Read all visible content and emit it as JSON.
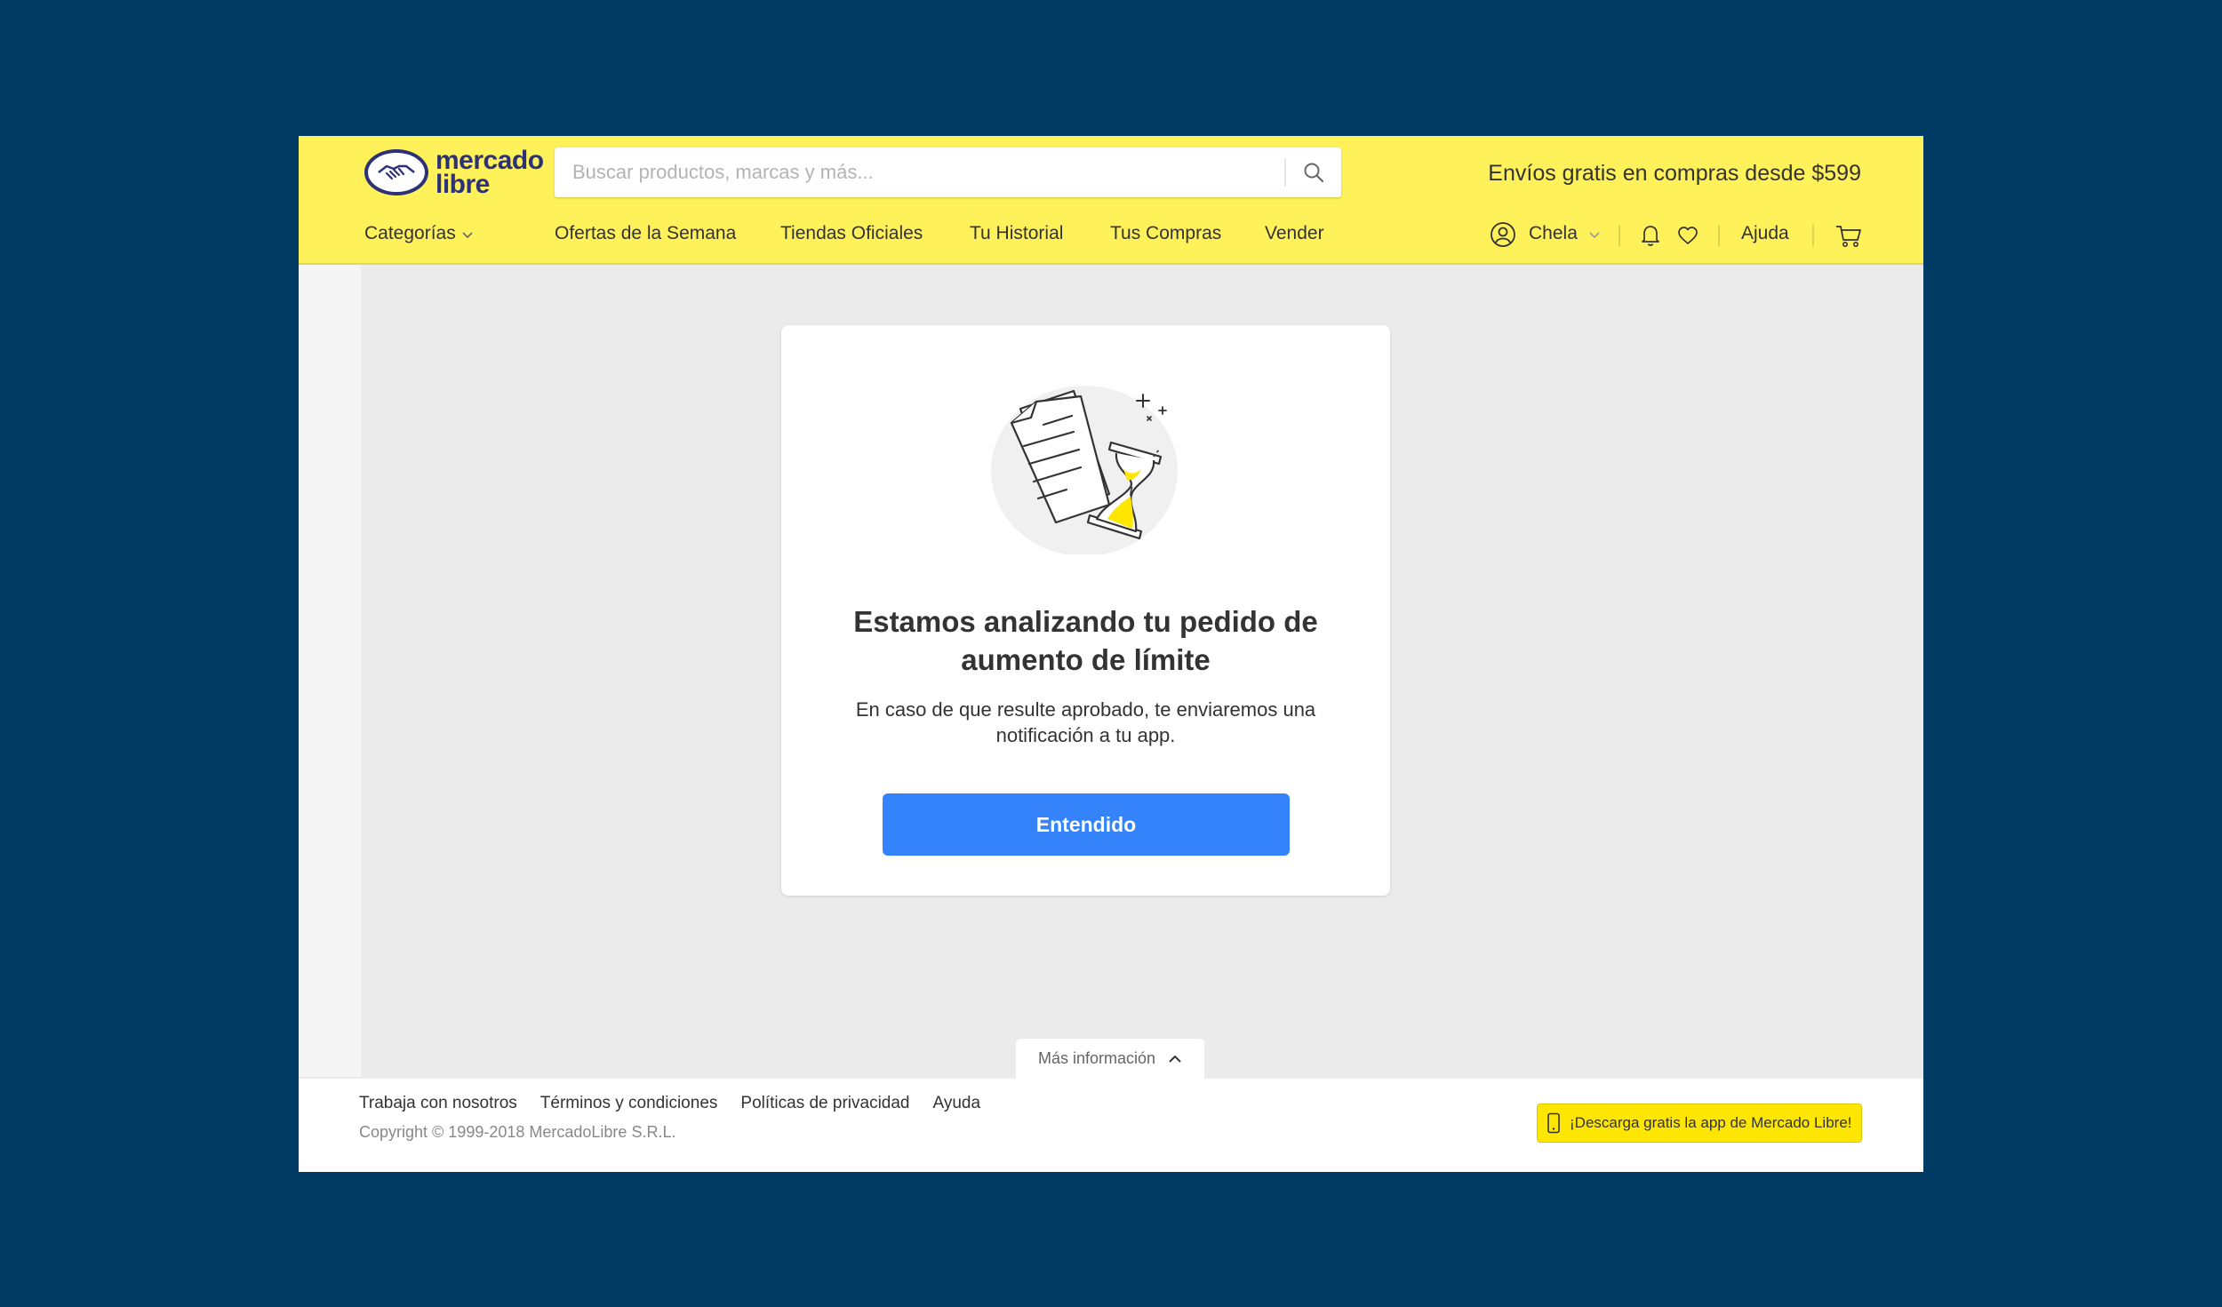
{
  "header": {
    "logo_text_line1": "mercado",
    "logo_text_line2": "libre",
    "search_placeholder": "Buscar productos, marcas y más...",
    "promo_text": "Envíos gratis en compras desde $599",
    "categories_label": "Categorías",
    "nav": [
      "Ofertas de la Semana",
      "Tiendas Oficiales",
      "Tu Historial",
      "Tus Compras",
      "Vender"
    ],
    "user_name": "Chela",
    "help_label": "Ajuda"
  },
  "card": {
    "title_line1": "Estamos analizando tu pedido de",
    "title_line2": "aumento de límite",
    "desc_line1": "En caso de que resulte aprobado, te enviaremos una",
    "desc_line2": "notificación a tu app.",
    "button_label": "Entendido"
  },
  "more_info_label": "Más información",
  "footer": {
    "links": [
      "Trabaja con nosotros",
      "Términos y condiciones",
      "Políticas de privacidad",
      "Ayuda"
    ],
    "copyright": "Copyright © 1999-2018 MercadoLibre S.R.L.",
    "app_download": "¡Descarga gratis la app de Mercado Libre!"
  },
  "colors": {
    "background": "#013a63",
    "header_yellow": "#fff159",
    "brand_blue": "#2d3277",
    "cta_blue": "#3483fa",
    "app_yellow": "#ffe600"
  },
  "icons": [
    "handshake-logo-icon",
    "search-icon",
    "chevron-down-icon",
    "user-icon",
    "bell-icon",
    "heart-icon",
    "cart-icon",
    "documents-hourglass-illustration",
    "chevron-up-icon",
    "phone-icon"
  ]
}
